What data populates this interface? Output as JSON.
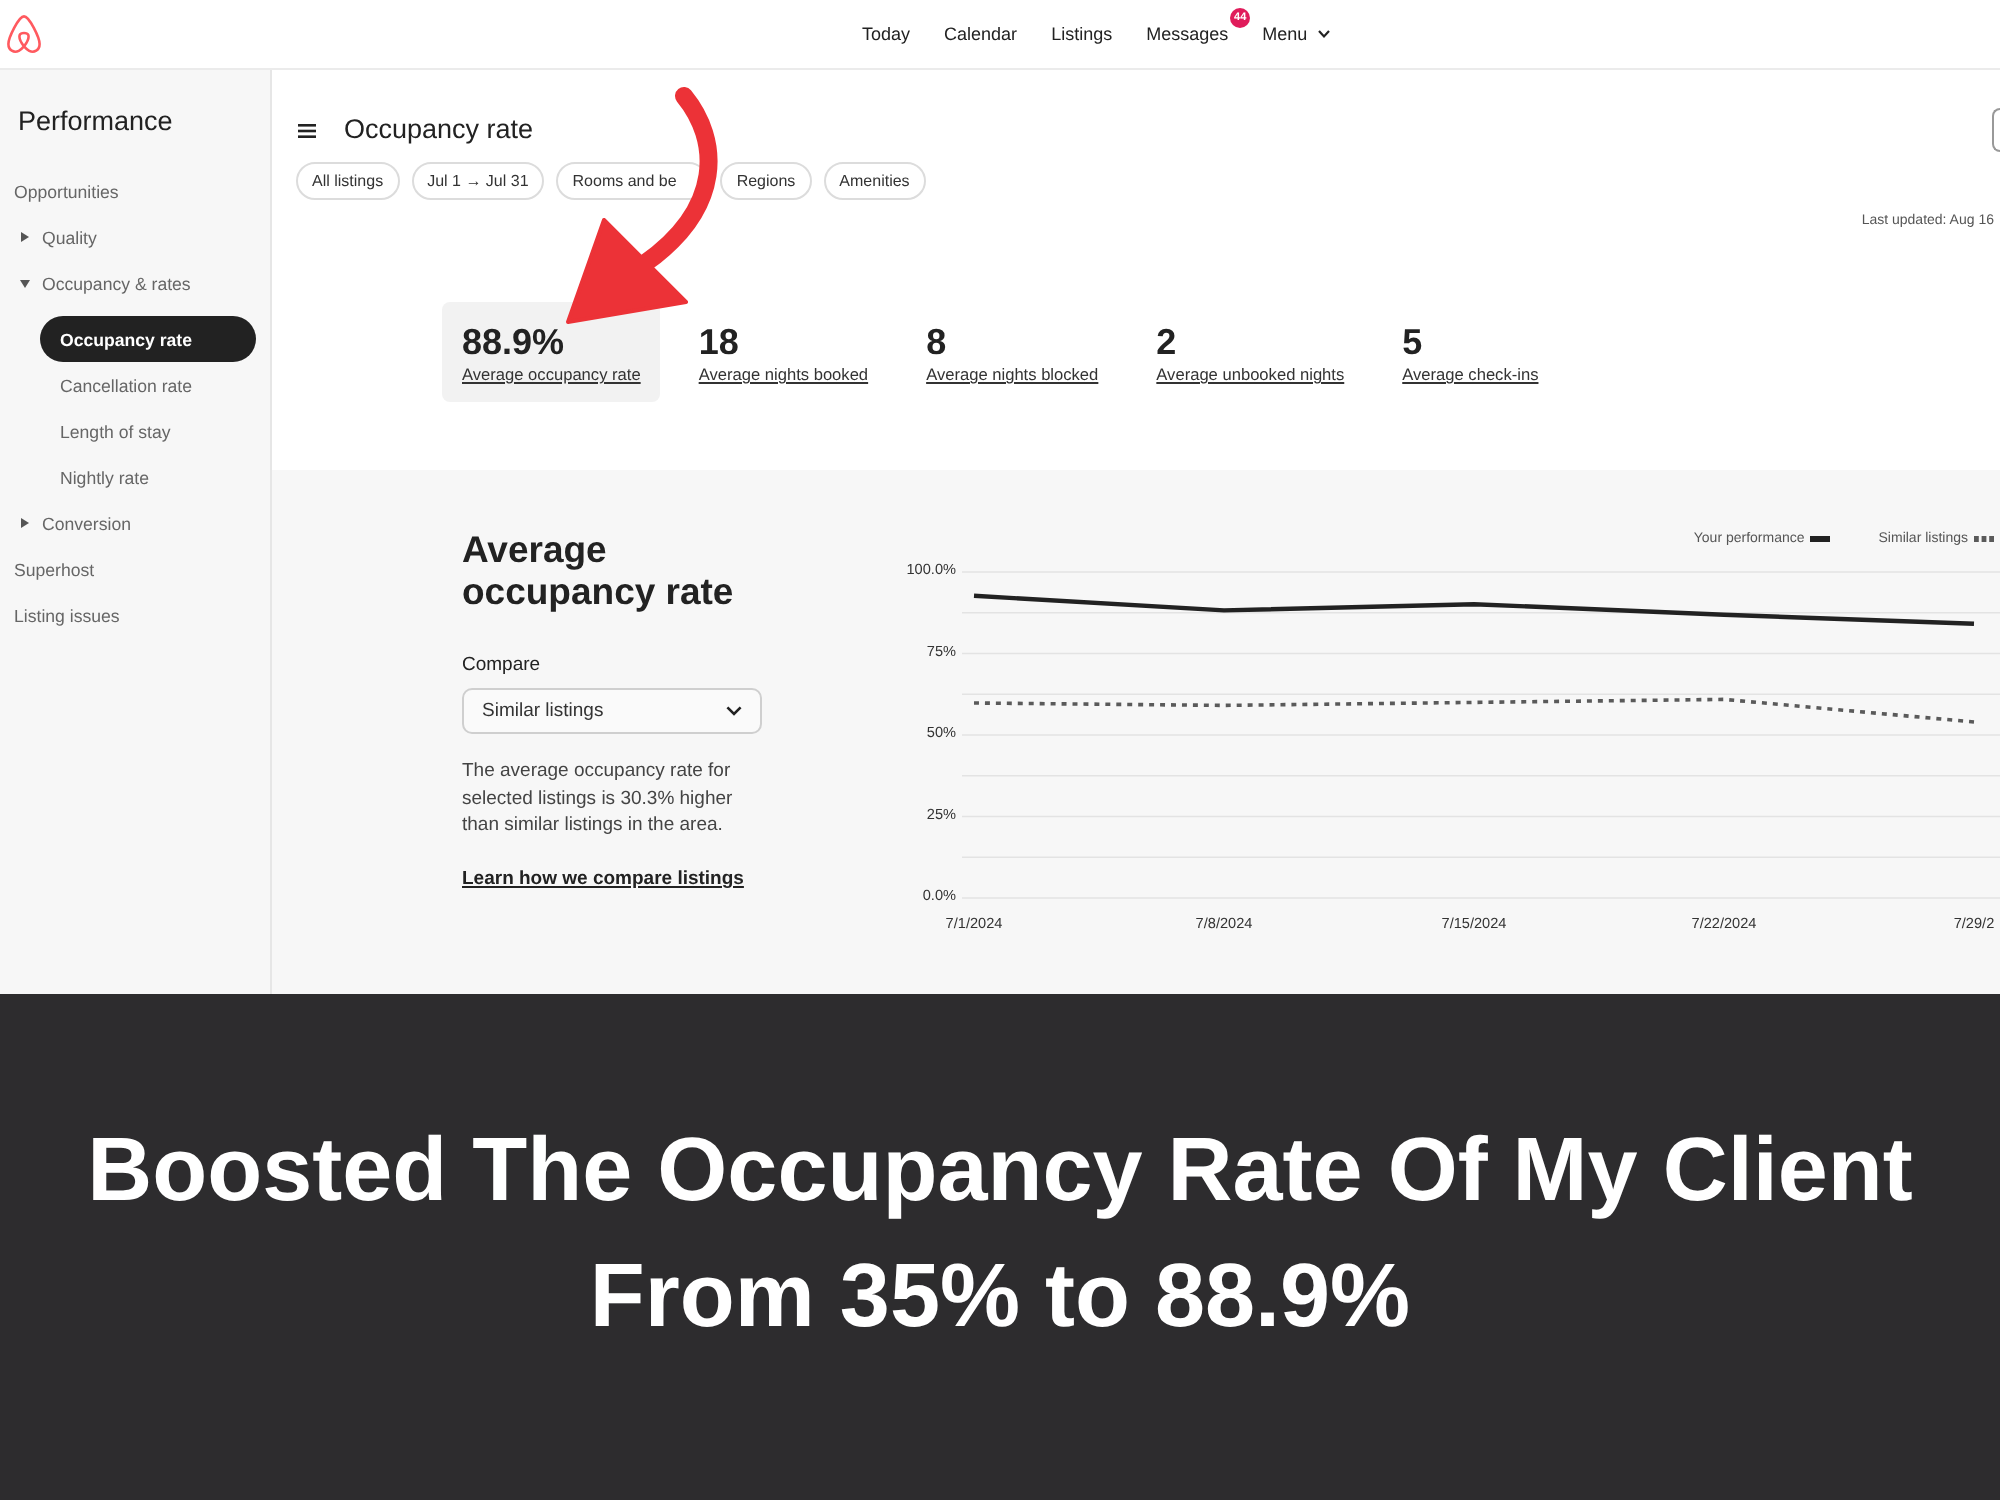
{
  "top_nav": {
    "items": [
      {
        "label": "Today",
        "kind": "link"
      },
      {
        "label": "Calendar",
        "kind": "link"
      },
      {
        "label": "Listings",
        "kind": "link"
      },
      {
        "label": "Messages",
        "kind": "link",
        "badge": "44"
      },
      {
        "label": "Menu",
        "kind": "menu"
      }
    ]
  },
  "sidebar": {
    "title": "Performance",
    "items": [
      {
        "label": "Opportunities",
        "kind": "link",
        "selected": false
      },
      {
        "label": "Quality",
        "kind": "group",
        "expanded": false,
        "selected": false
      },
      {
        "label": "Occupancy & rates",
        "kind": "group",
        "expanded": true,
        "selected": false,
        "children": [
          {
            "label": "Occupancy rate",
            "selected": true
          },
          {
            "label": "Cancellation rate",
            "selected": false
          },
          {
            "label": "Length of stay",
            "selected": false
          },
          {
            "label": "Nightly rate",
            "selected": false
          }
        ]
      },
      {
        "label": "Conversion",
        "kind": "group",
        "expanded": false,
        "selected": false
      },
      {
        "label": "Superhost",
        "kind": "link",
        "selected": false
      },
      {
        "label": "Listing issues",
        "kind": "link",
        "selected": false
      }
    ]
  },
  "page": {
    "title": "Occupancy rate",
    "filters": [
      "All listings",
      "Jul 1 → Jul 31",
      "Rooms and be",
      "Regions",
      "Amenities"
    ],
    "last_updated": "Last updated: Aug 16"
  },
  "stats": [
    {
      "value": "88.9%",
      "label": "Average occupancy rate",
      "selected": true
    },
    {
      "value": "18",
      "label": "Average nights booked",
      "selected": false
    },
    {
      "value": "8",
      "label": "Average nights blocked",
      "selected": false
    },
    {
      "value": "2",
      "label": "Average unbooked nights",
      "selected": false
    },
    {
      "value": "5",
      "label": "Average check-ins",
      "selected": false
    }
  ],
  "detail": {
    "title": "Average occupancy rate",
    "compare_label": "Compare",
    "compare_value": "Similar listings",
    "description": "The average occupancy rate for selected listings is 30.3% higher than similar listings in the area.",
    "link": "Learn how we compare listings"
  },
  "chart": {
    "chart_data": {
      "type": "line",
      "categories": [
        "7/1/2024",
        "7/8/2024",
        "7/15/2024",
        "7/22/2024",
        "7/29/2"
      ],
      "series": [
        {
          "name": "Your performance",
          "color": "#222222",
          "line_style": "solid",
          "values": [
            92.7,
            88.2,
            90.1,
            86.9,
            84.1
          ]
        },
        {
          "name": "Similar listings",
          "color": "#5a5a5a",
          "line_style": "dashed",
          "values": [
            59.8,
            59.1,
            60,
            60.9,
            54
          ]
        }
      ],
      "ylim": [
        0,
        100
      ],
      "yticks": [
        {
          "value": 0,
          "label": "0.0%"
        },
        {
          "value": 25,
          "label": "25%"
        },
        {
          "value": 50,
          "label": "50%"
        },
        {
          "value": 75,
          "label": "75%"
        },
        {
          "value": 100,
          "label": "100.0%"
        }
      ],
      "grid": true,
      "legend": "top-right"
    }
  },
  "caption": {
    "lines": [
      "Boosted The Occupancy Rate Of My Client",
      "From 35% to 88.9%"
    ]
  }
}
